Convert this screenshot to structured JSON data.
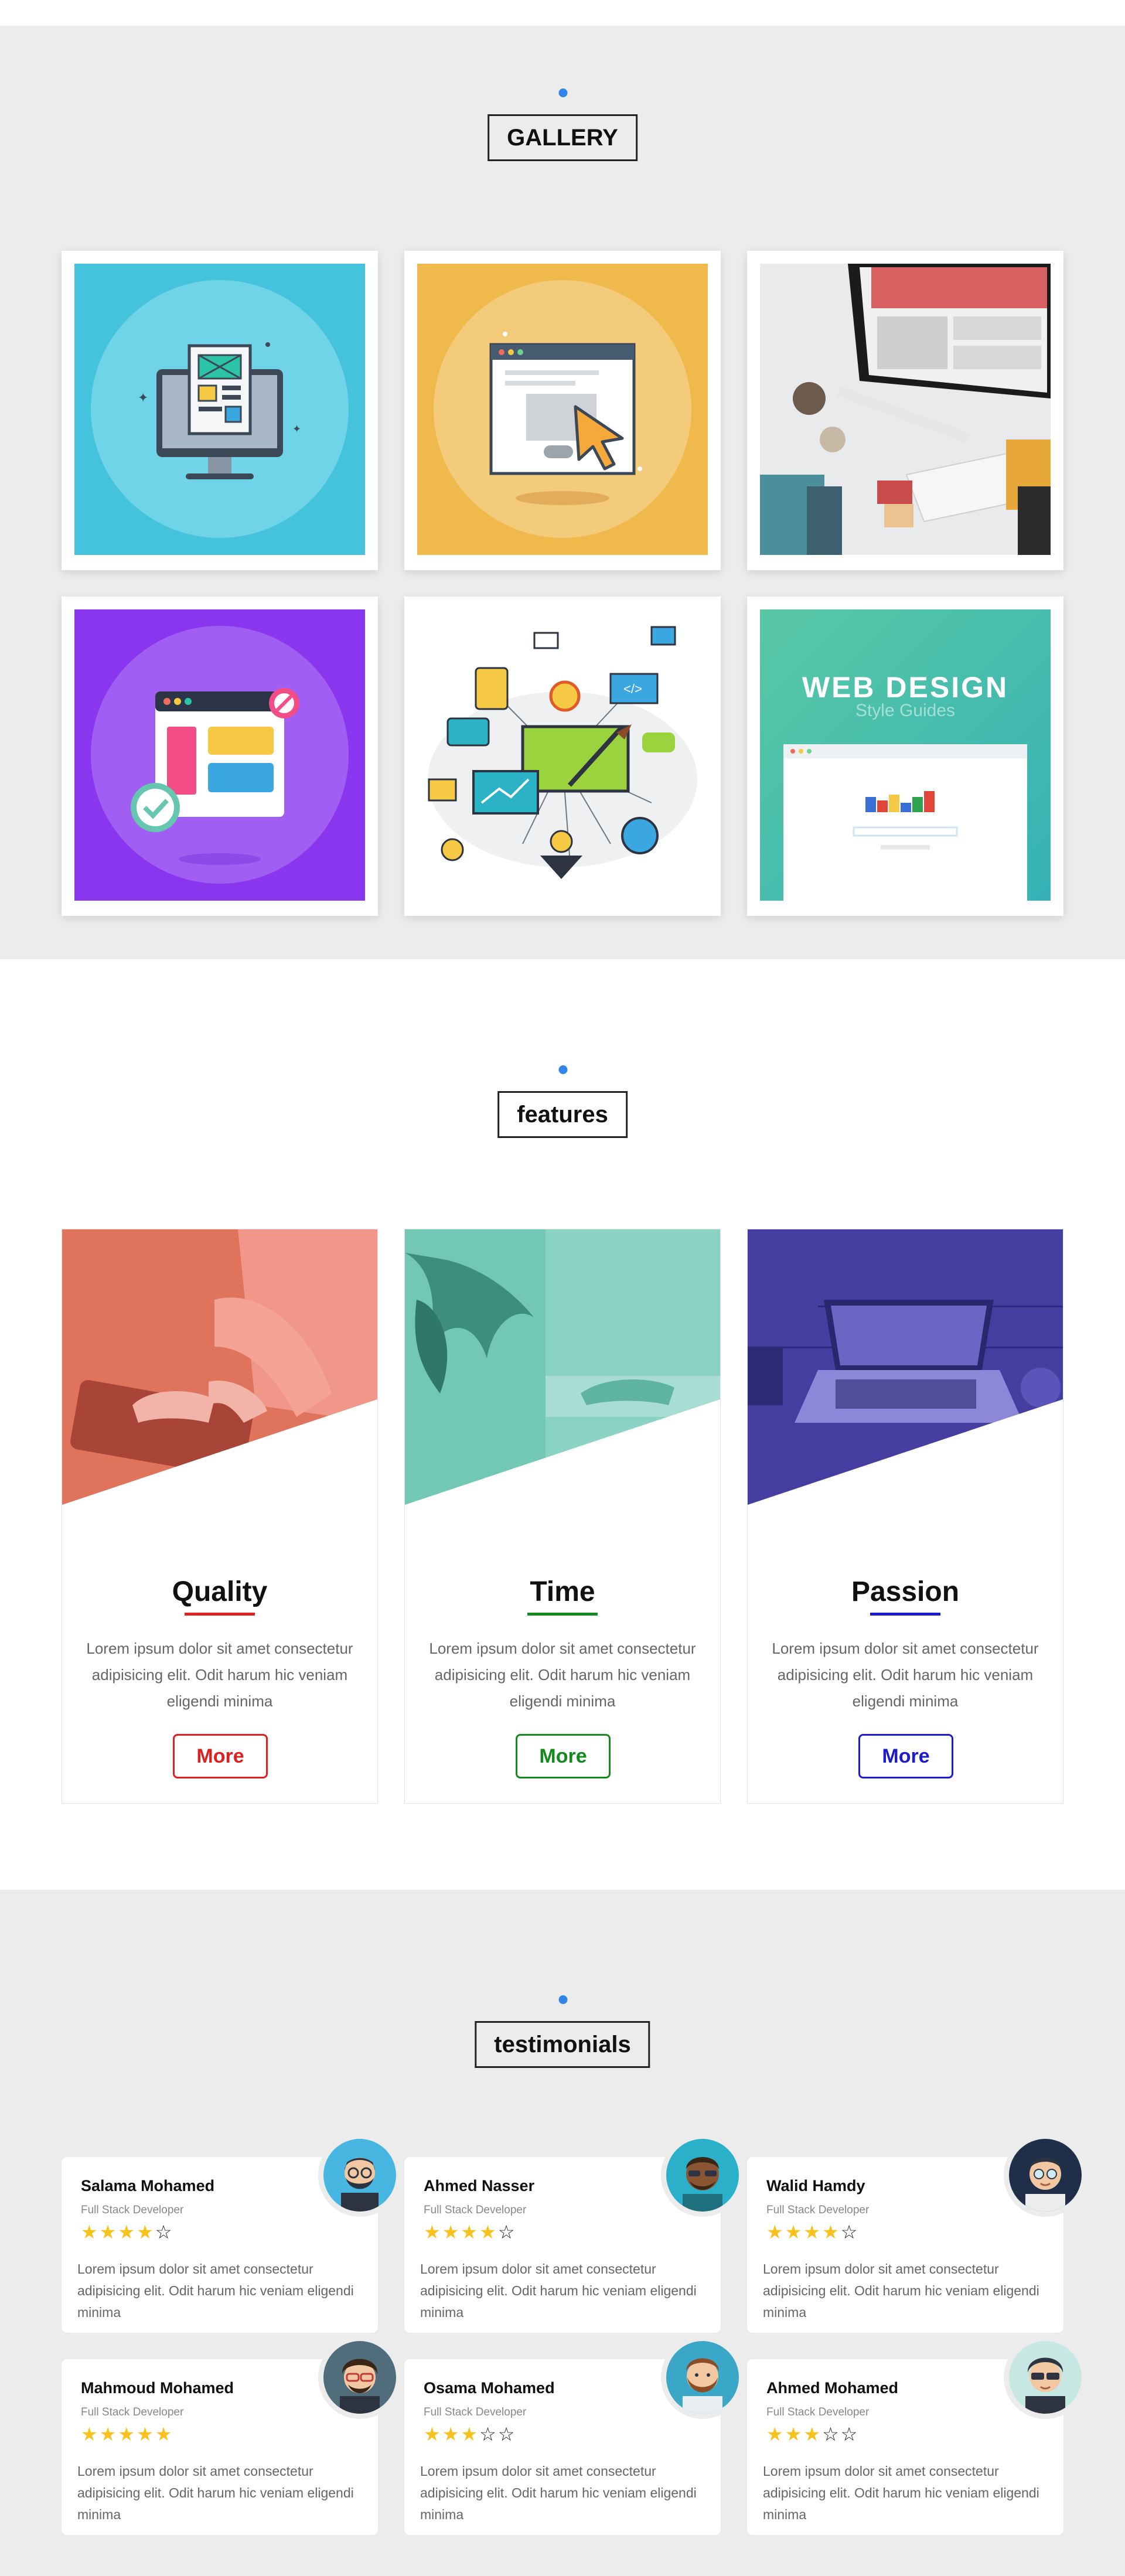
{
  "gallery": {
    "heading": "GALLERY",
    "items": [
      {
        "name": "computer-monitor-illustration"
      },
      {
        "name": "browser-window-cursor-illustration"
      },
      {
        "name": "designer-desk-photo"
      },
      {
        "name": "app-interface-checkmark-illustration"
      },
      {
        "name": "digital-marketing-icons-illustration"
      },
      {
        "name": "web-design-style-guide-image",
        "title": "WEB DESIGN",
        "subtitle": "Style Guides"
      }
    ]
  },
  "features": {
    "heading": "features",
    "cards": [
      {
        "title": "Quality",
        "text": "Lorem ipsum dolor sit amet consectetur adipisicing elit. Odit harum hic veniam eligendi minima",
        "button": "More",
        "color": "#e02020"
      },
      {
        "title": "Time",
        "text": "Lorem ipsum dolor sit amet consectetur adipisicing elit. Odit harum hic veniam eligendi minima",
        "button": "More",
        "color": "#138a1e"
      },
      {
        "title": "Passion",
        "text": "Lorem ipsum dolor sit amet consectetur adipisicing elit. Odit harum hic veniam eligendi minima",
        "button": "More",
        "color": "#1b1bd0"
      }
    ]
  },
  "testimonials": {
    "heading": "testimonials",
    "items": [
      {
        "name": "Salama Mohamed",
        "role": "Full Stack Developer",
        "rating": 4,
        "text": "Lorem ipsum dolor sit amet consectetur adipisicing elit. Odit harum hic veniam eligendi minima"
      },
      {
        "name": "Ahmed Nasser",
        "role": "Full Stack Developer",
        "rating": 4,
        "text": "Lorem ipsum dolor sit amet consectetur adipisicing elit. Odit harum hic veniam eligendi minima"
      },
      {
        "name": "Walid Hamdy",
        "role": "Full Stack Developer",
        "rating": 4,
        "text": "Lorem ipsum dolor sit amet consectetur adipisicing elit. Odit harum hic veniam eligendi minima"
      },
      {
        "name": "Mahmoud Mohamed",
        "role": "Full Stack Developer",
        "rating": 5,
        "text": "Lorem ipsum dolor sit amet consectetur adipisicing elit. Odit harum hic veniam eligendi minima"
      },
      {
        "name": "Osama Mohamed",
        "role": "Full Stack Developer",
        "rating": 3,
        "text": "Lorem ipsum dolor sit amet consectetur adipisicing elit. Odit harum hic veniam eligendi minima"
      },
      {
        "name": "Ahmed Mohamed",
        "role": "Full Stack Developer",
        "rating": 3,
        "text": "Lorem ipsum dolor sit amet consectetur adipisicing elit. Odit harum hic veniam eligendi minima"
      }
    ]
  },
  "colors": {
    "accent_dot": "#2f86e6",
    "section_gray": "#ececec",
    "star": "#f7c21e"
  }
}
